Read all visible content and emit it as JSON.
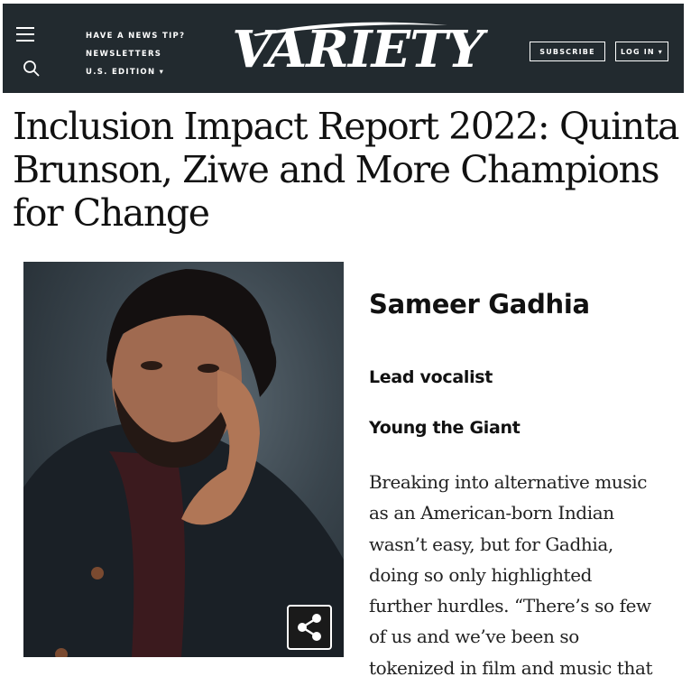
{
  "header": {
    "links": [
      "HAVE A NEWS TIP?",
      "NEWSLETTERS",
      "U.S. EDITION ▾"
    ],
    "logo": "VARIETY",
    "subscribe_label": "SUBSCRIBE",
    "login_label": "LOG IN ▾"
  },
  "article": {
    "headline": "Inclusion Impact Report 2022: Quinta Brunson, Ziwe and More Champions for Change"
  },
  "profile": {
    "name": "Sameer Gadhia",
    "role": "Lead vocalist",
    "band": "Young the Giant",
    "bio_lines": [
      "Breaking into alternative music",
      "as an American-born Indian",
      "wasn’t easy, but for Gadhia,",
      "doing so only highlighted",
      "further hurdles. “There’s so few",
      "of us and we’ve been so",
      "tokenized in film and music that"
    ]
  },
  "icons": {
    "menu": "hamburger-menu-icon",
    "search": "search-icon",
    "share": "share-icon"
  },
  "colors": {
    "header_bg": "#222a2f",
    "text": "#111111",
    "share_bg": "#1a1a1a"
  }
}
